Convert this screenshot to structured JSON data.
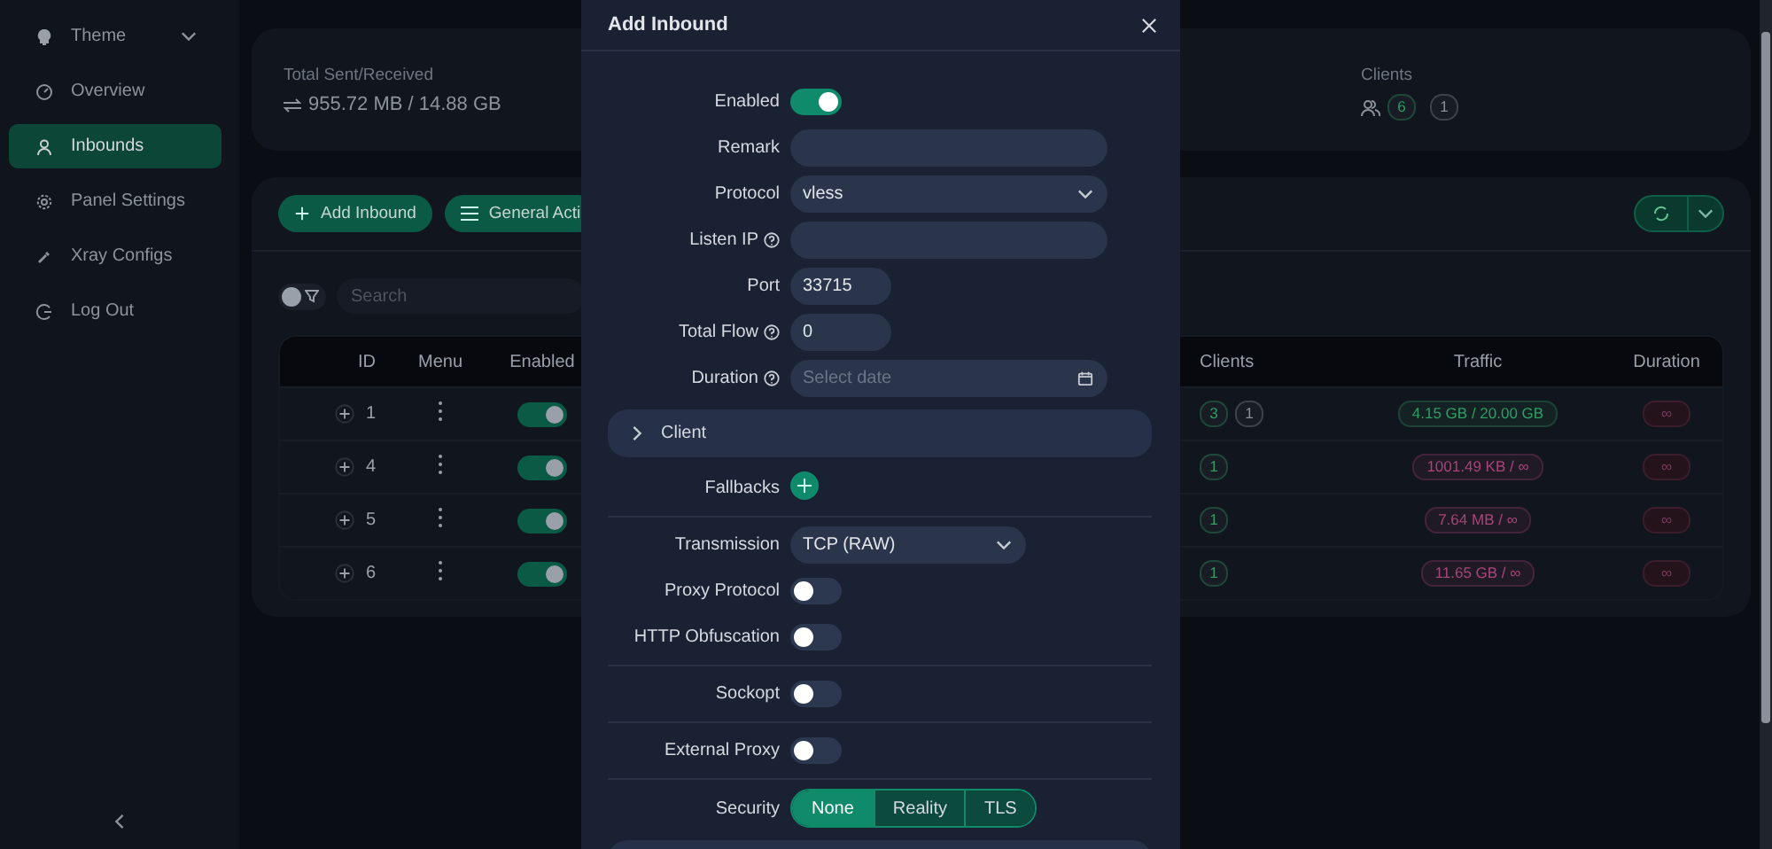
{
  "sidebar": {
    "items": [
      {
        "label": "Theme",
        "kind": "submenu",
        "selected": false
      },
      {
        "label": "Overview",
        "kind": "link",
        "selected": false
      },
      {
        "label": "Inbounds",
        "kind": "link",
        "selected": true
      },
      {
        "label": "Panel Settings",
        "kind": "link",
        "selected": false
      },
      {
        "label": "Xray Configs",
        "kind": "link",
        "selected": false
      },
      {
        "label": "Log Out",
        "kind": "link",
        "selected": false
      }
    ]
  },
  "stats": {
    "total": {
      "label": "Total Sent/Received",
      "value": "955.72 MB / 14.88 GB"
    },
    "clients": {
      "label": "Clients",
      "badges": [
        {
          "text": "6",
          "color": "#2f9e62"
        },
        {
          "text": "1",
          "color": "#8a8f99"
        }
      ]
    }
  },
  "toolbar": {
    "buttons": [
      {
        "label": "Add Inbound",
        "kind": "add"
      },
      {
        "label": "General Acti",
        "kind": "menu"
      }
    ]
  },
  "filter": {
    "on": false,
    "placeholder": "Search"
  },
  "table": {
    "columns": [
      "ID",
      "Menu",
      "Enabled",
      "Clients",
      "Traffic",
      "Duration"
    ],
    "rows": [
      {
        "id": "1",
        "enabled": true,
        "clients": [
          {
            "text": "3",
            "color": "#2f9e62"
          },
          {
            "text": "1",
            "color": "#8a8f99"
          }
        ],
        "traffic": {
          "text": "4.15 GB / 20.00 GB",
          "color": "#2f9e62"
        },
        "duration": "∞"
      },
      {
        "id": "4",
        "enabled": true,
        "clients": [
          {
            "text": "1",
            "color": "#2f9e62"
          }
        ],
        "traffic": {
          "text": "1001.49 KB / ∞",
          "color": "#a8457a"
        },
        "duration": "∞"
      },
      {
        "id": "5",
        "enabled": true,
        "clients": [
          {
            "text": "1",
            "color": "#2f9e62"
          }
        ],
        "traffic": {
          "text": "7.64 MB / ∞",
          "color": "#a8457a"
        },
        "duration": "∞"
      },
      {
        "id": "6",
        "enabled": true,
        "clients": [
          {
            "text": "1",
            "color": "#2f9e62"
          }
        ],
        "traffic": {
          "text": "11.65 GB / ∞",
          "color": "#a8457a"
        },
        "duration": "∞"
      }
    ]
  },
  "modal": {
    "title": "Add Inbound",
    "fields": [
      {
        "kind": "switch",
        "label": "Enabled",
        "on": true
      },
      {
        "kind": "input",
        "label": "Remark"
      },
      {
        "kind": "select",
        "label": "Protocol",
        "value": "vless"
      },
      {
        "kind": "input",
        "label": "Listen IP",
        "help": true
      },
      {
        "kind": "number",
        "label": "Port",
        "value": "33715"
      },
      {
        "kind": "number",
        "label": "Total Flow",
        "value": "0",
        "help": true
      },
      {
        "kind": "date",
        "label": "Duration",
        "placeholder": "Select date",
        "help": true
      },
      {
        "kind": "panel",
        "label": "Client",
        "expanded": false
      },
      {
        "kind": "add",
        "label": "Fallbacks"
      },
      {
        "kind": "divider"
      },
      {
        "kind": "dropdown",
        "label": "Transmission",
        "value": "TCP (RAW)"
      },
      {
        "kind": "switch",
        "label": "Proxy Protocol",
        "on": false
      },
      {
        "kind": "switch",
        "label": "HTTP Obfuscation",
        "on": false
      },
      {
        "kind": "divider"
      },
      {
        "kind": "switch",
        "label": "Sockopt",
        "on": false
      },
      {
        "kind": "divider"
      },
      {
        "kind": "switch",
        "label": "External Proxy",
        "on": false
      },
      {
        "kind": "divider"
      },
      {
        "kind": "segmented",
        "label": "Security",
        "options": [
          {
            "label": "None",
            "selected": true
          },
          {
            "label": "Reality",
            "selected": false
          },
          {
            "label": "TLS",
            "selected": false
          }
        ]
      },
      {
        "kind": "panel"
      }
    ]
  }
}
